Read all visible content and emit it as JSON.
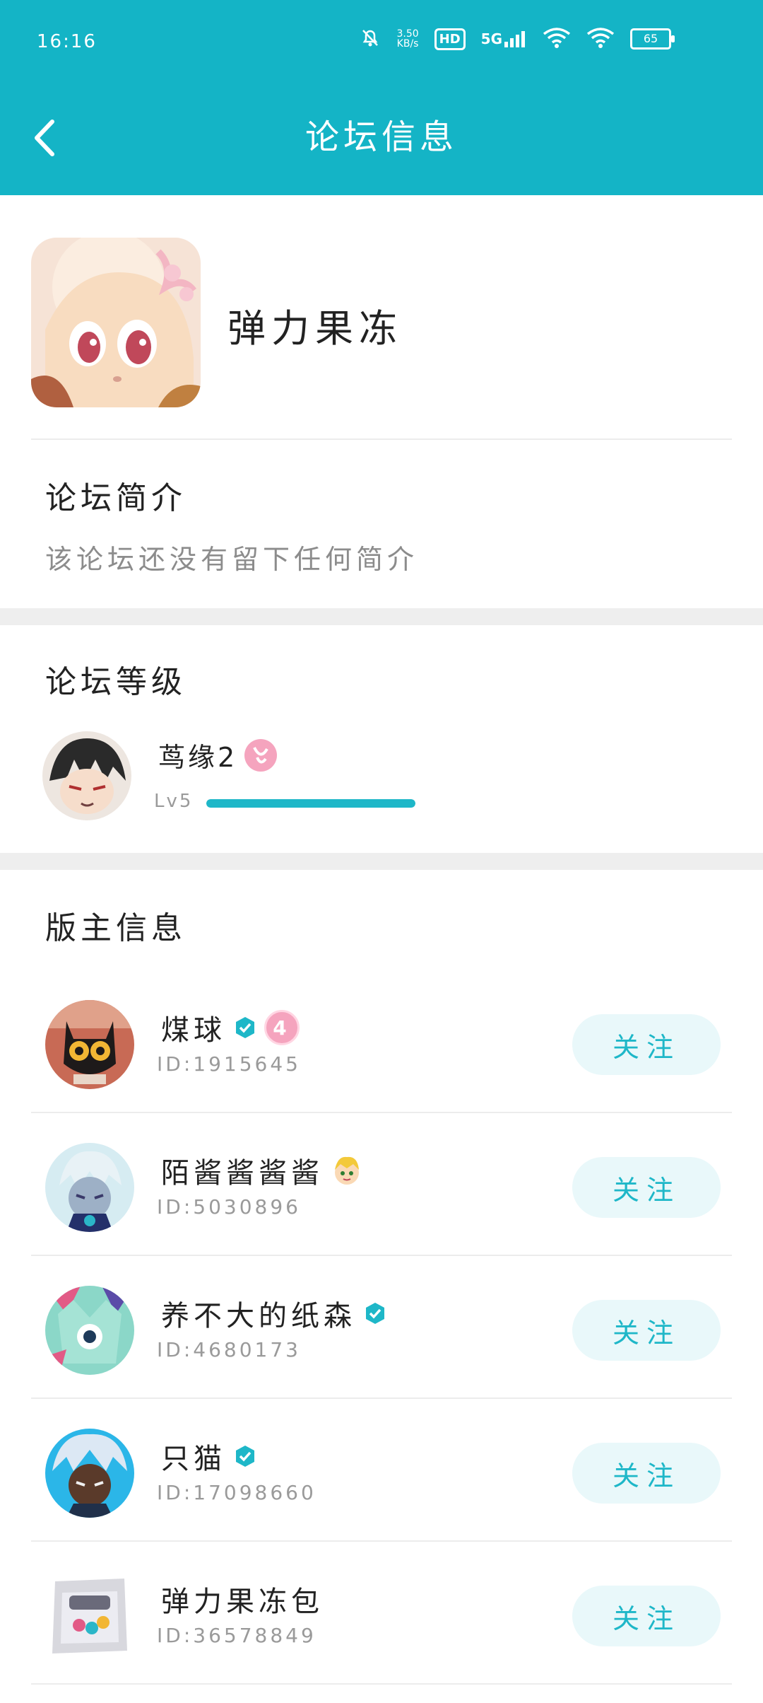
{
  "status": {
    "time": "16:16",
    "net_speed_top": "3.50",
    "net_speed_bottom": "KB/s",
    "hd": "HD",
    "five_g": "5G",
    "battery": "65"
  },
  "header": {
    "title": "论坛信息"
  },
  "forum": {
    "name": "弹力果冻"
  },
  "intro": {
    "title": "论坛简介",
    "text": "该论坛还没有留下任何简介"
  },
  "level": {
    "title": "论坛等级",
    "user": "茑缘2",
    "label": "Lv5",
    "progress": 1.0
  },
  "moderators": {
    "title": "版主信息",
    "follow_label": "关注",
    "items": [
      {
        "name": "煤球",
        "id": "ID:1915645",
        "verified": true,
        "badge": "4"
      },
      {
        "name": "陌酱酱酱酱",
        "id": "ID:5030896",
        "verified": false,
        "badge": ""
      },
      {
        "name": "养不大的纸森",
        "id": "ID:4680173",
        "verified": true,
        "badge": ""
      },
      {
        "name": "只猫",
        "id": "ID:17098660",
        "verified": true,
        "badge": ""
      },
      {
        "name": "弹力果冻包",
        "id": "ID:36578849",
        "verified": false,
        "badge": ""
      }
    ]
  },
  "colors": {
    "primary": "#14B4C6",
    "accent": "#1EB7C8",
    "follow_bg": "#E9F8FA",
    "badge_pink": "#F5A4BE"
  }
}
